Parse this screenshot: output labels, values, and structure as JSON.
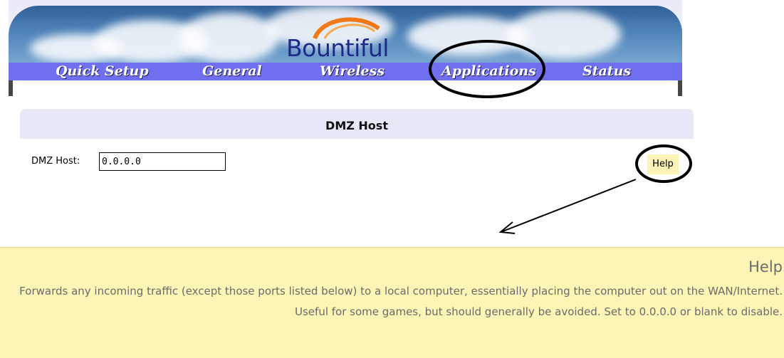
{
  "brand": {
    "logo_text": "Bountiful"
  },
  "nav": {
    "items": [
      {
        "label": "Quick Setup"
      },
      {
        "label": "General"
      },
      {
        "label": "Wireless"
      },
      {
        "label": "Applications",
        "highlighted": true
      },
      {
        "label": "Status"
      }
    ]
  },
  "panel": {
    "title": "DMZ Host",
    "field_label": "DMZ Host:",
    "field_value": "0.0.0.0",
    "help_button": "Help"
  },
  "help": {
    "title": "Help",
    "text": "Forwards any incoming traffic (except those ports listed below) to a local computer, essentially placing the computer out on the WAN/Internet. Useful for some games, but should generally be avoided. Set to 0.0.0.0 or blank to disable."
  },
  "colors": {
    "nav_bg": "#6f6ff0",
    "panel_head_bg": "#e6e8f8",
    "help_bg": "#fdf5b5",
    "help_button_bg": "#fbf3b8"
  }
}
